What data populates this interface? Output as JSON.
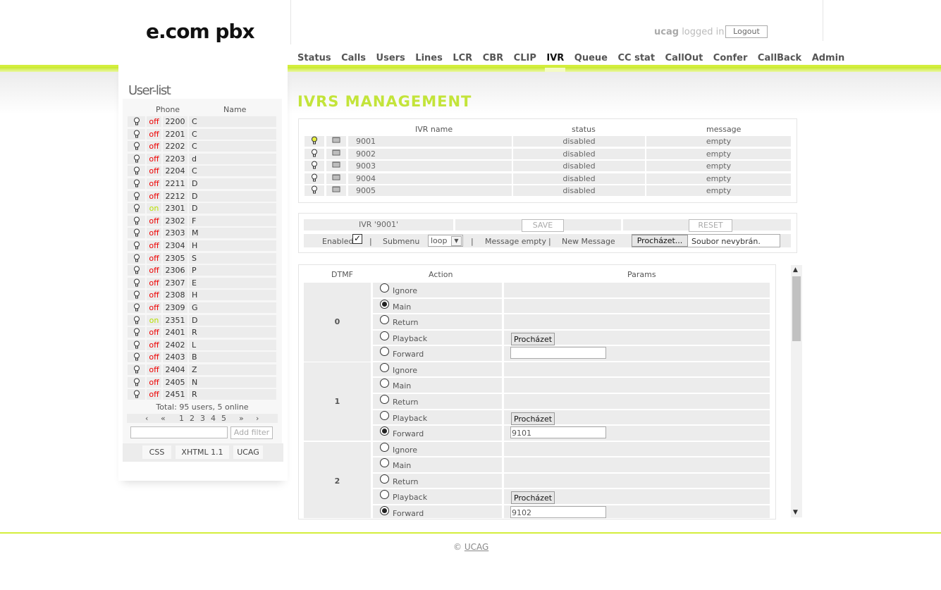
{
  "header": {
    "logo": "e.com pbx",
    "user": "ucag",
    "logged_in_text": "logged in",
    "logout_label": "Logout"
  },
  "nav": {
    "items": [
      "Status",
      "Calls",
      "Users",
      "Lines",
      "LCR",
      "CBR",
      "CLIP",
      "IVR",
      "Queue",
      "CC stat",
      "CallOut",
      "Confer",
      "CallBack",
      "Admin"
    ],
    "active": "IVR"
  },
  "sidebar": {
    "title": "User-list",
    "col_phone": "Phone",
    "col_name": "Name",
    "users": [
      {
        "status": "off",
        "phone": "2200",
        "name": "C"
      },
      {
        "status": "off",
        "phone": "2201",
        "name": "C"
      },
      {
        "status": "off",
        "phone": "2202",
        "name": "C"
      },
      {
        "status": "off",
        "phone": "2203",
        "name": "d"
      },
      {
        "status": "off",
        "phone": "2204",
        "name": "C"
      },
      {
        "status": "off",
        "phone": "2211",
        "name": "D"
      },
      {
        "status": "off",
        "phone": "2212",
        "name": "D"
      },
      {
        "status": "on",
        "phone": "2301",
        "name": "D"
      },
      {
        "status": "off",
        "phone": "2302",
        "name": "F"
      },
      {
        "status": "off",
        "phone": "2303",
        "name": "M"
      },
      {
        "status": "off",
        "phone": "2304",
        "name": "H"
      },
      {
        "status": "off",
        "phone": "2305",
        "name": "S"
      },
      {
        "status": "off",
        "phone": "2306",
        "name": "P"
      },
      {
        "status": "off",
        "phone": "2307",
        "name": "E"
      },
      {
        "status": "off",
        "phone": "2308",
        "name": "H"
      },
      {
        "status": "off",
        "phone": "2309",
        "name": "G"
      },
      {
        "status": "on",
        "phone": "2351",
        "name": "D"
      },
      {
        "status": "off",
        "phone": "2401",
        "name": "R"
      },
      {
        "status": "off",
        "phone": "2402",
        "name": "L"
      },
      {
        "status": "off",
        "phone": "2403",
        "name": "B"
      },
      {
        "status": "off",
        "phone": "2404",
        "name": "Z"
      },
      {
        "status": "off",
        "phone": "2405",
        "name": "N"
      },
      {
        "status": "off",
        "phone": "2451",
        "name": "R"
      }
    ],
    "total": "Total: 95 users, 5 online",
    "pager": {
      "prev": "‹",
      "first": "«",
      "pages": [
        "1",
        "2",
        "3",
        "4",
        "5"
      ],
      "last": "»",
      "next": "›"
    },
    "filter_button": "Add filter",
    "badges": [
      "CSS",
      "XHTML 1.1",
      "UCAG"
    ]
  },
  "main": {
    "title": "IVRS MANAGEMENT",
    "ivr_table": {
      "headers": [
        "IVR name",
        "status",
        "message"
      ],
      "rows": [
        {
          "name": "9001",
          "status": "disabled",
          "message": "empty",
          "active": true
        },
        {
          "name": "9002",
          "status": "disabled",
          "message": "empty",
          "active": false
        },
        {
          "name": "9003",
          "status": "disabled",
          "message": "empty",
          "active": false
        },
        {
          "name": "9004",
          "status": "disabled",
          "message": "empty",
          "active": false
        },
        {
          "name": "9005",
          "status": "disabled",
          "message": "empty",
          "active": false
        }
      ]
    },
    "edit": {
      "ivr_label": "IVR '9001'",
      "save": "SAVE",
      "reset": "RESET",
      "enabled_label": "Enabled",
      "sep": "|",
      "submenu_label": "Submenu",
      "submenu_value": "loop",
      "message_label": "Message empty",
      "new_message_label": "New Message",
      "browse_label": "Procházet...",
      "no_file": "Soubor nevybrán."
    },
    "dtmf": {
      "headers": [
        "DTMF",
        "Action",
        "Params"
      ],
      "actions": [
        "Ignore",
        "Main",
        "Return",
        "Playback",
        "Forward"
      ],
      "browse_label": "Procházet",
      "groups": [
        {
          "key": "0",
          "selected": "Main",
          "forward": ""
        },
        {
          "key": "1",
          "selected": "Forward",
          "forward": "9101"
        },
        {
          "key": "2",
          "selected": "Forward",
          "forward": "9102"
        }
      ]
    }
  },
  "footer": {
    "copyright": "©",
    "link": "UCAG"
  }
}
